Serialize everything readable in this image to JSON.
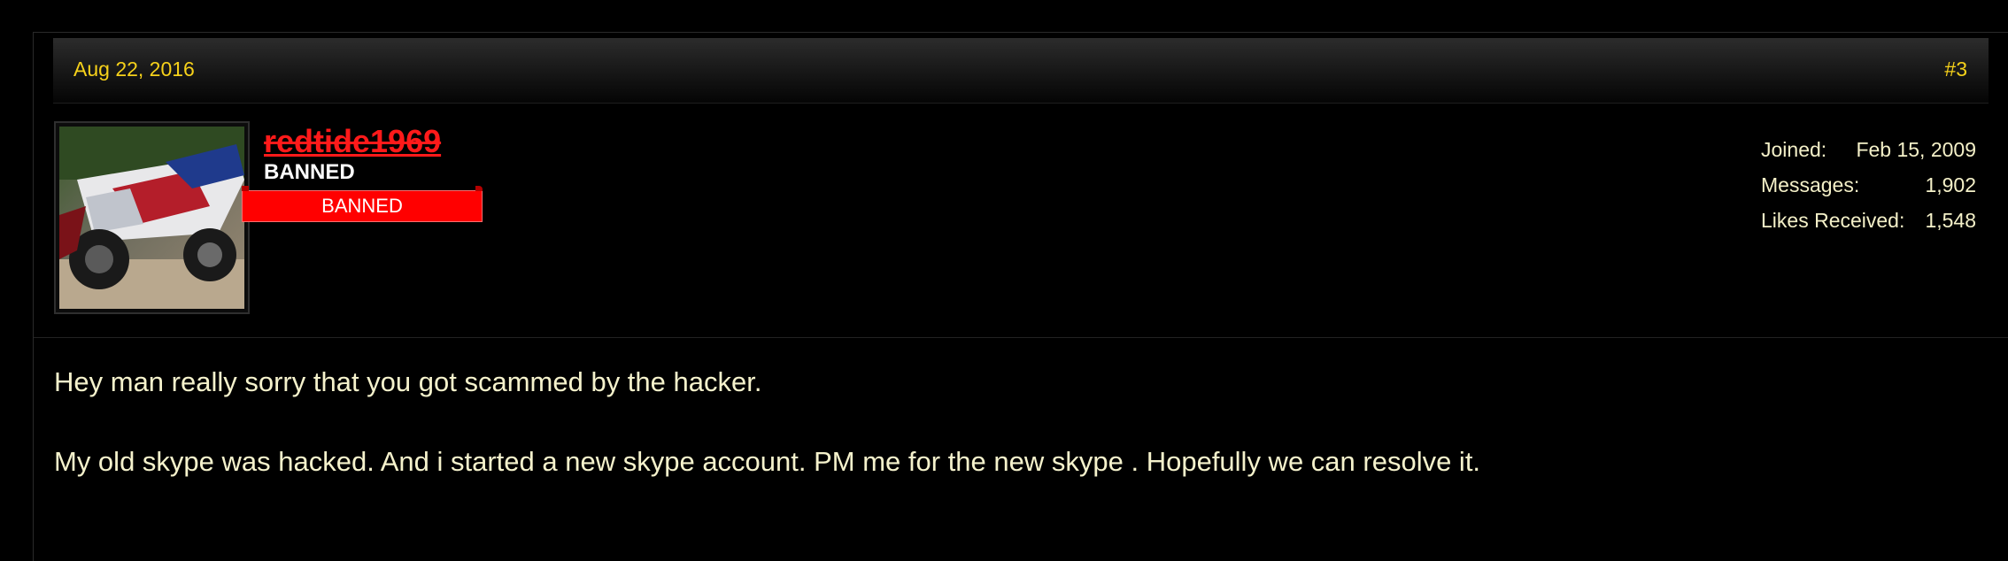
{
  "post": {
    "date": "Aug 22, 2016",
    "number": "#3"
  },
  "user": {
    "username": "redtide1969",
    "title": "BANNED",
    "banner": "BANNED",
    "avatar_icon": "motorcycle-avatar-icon"
  },
  "stats": {
    "joined_label": "Joined:",
    "joined_value": "Feb 15, 2009",
    "messages_label": "Messages:",
    "messages_value": "1,902",
    "likes_label": "Likes Received:",
    "likes_value": "1,548"
  },
  "message": {
    "line1": "Hey man really sorry that you got scammed by the hacker.",
    "line2": "My old skype was hacked. And i started a new skype account. PM me for the new skype . Hopefully we can resolve it."
  },
  "colors": {
    "accent": "#f6d11a",
    "banned": "#ff0000",
    "text": "#f5f2cc",
    "background": "#000000"
  }
}
